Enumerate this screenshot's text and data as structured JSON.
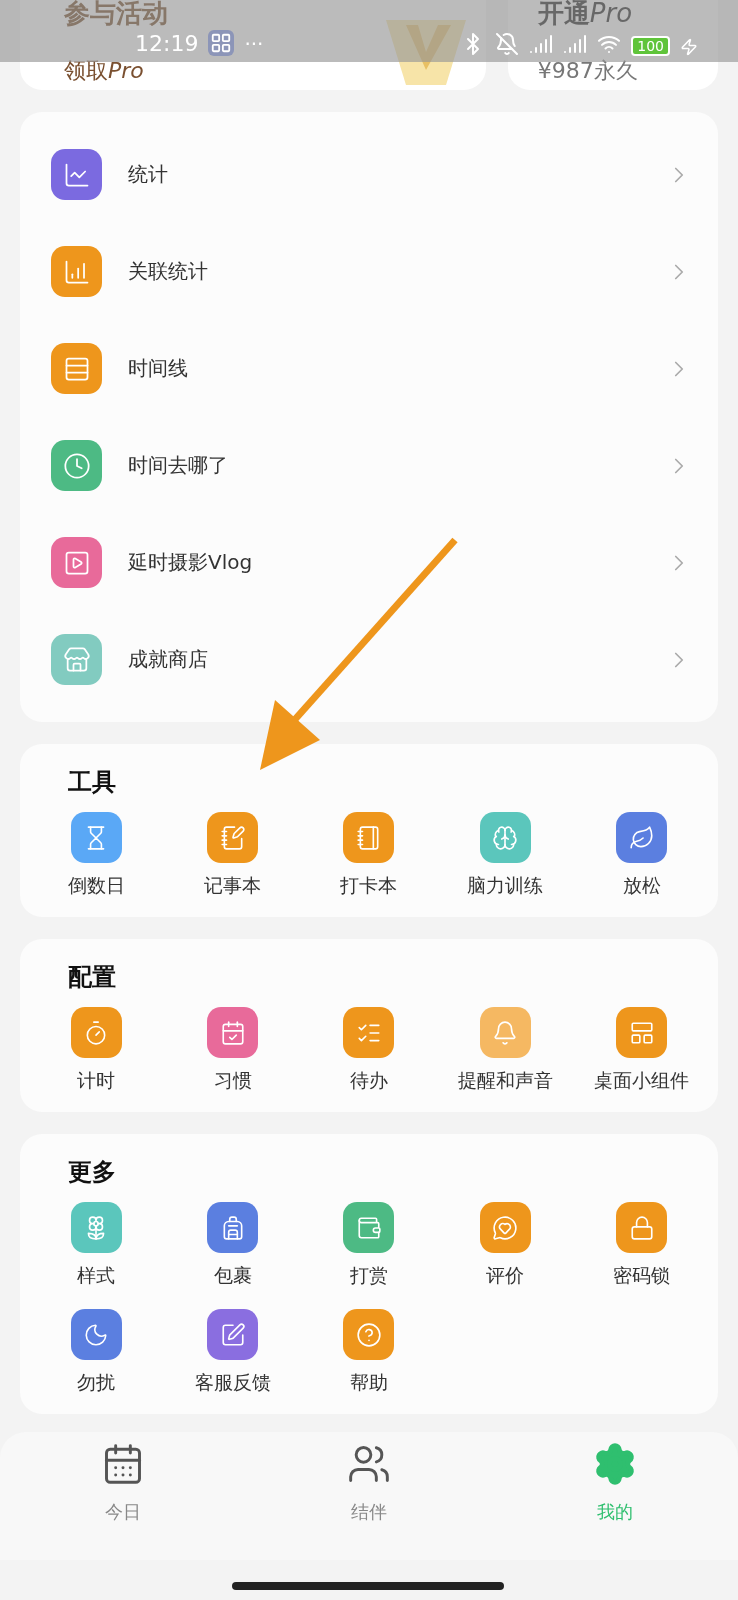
{
  "status_bar": {
    "time": "12:19",
    "more": "···",
    "battery": "100"
  },
  "promo_cards": [
    {
      "title": "参与活动",
      "subtitle": "领取",
      "subtitle_italic": "Pro"
    },
    {
      "title": "开通",
      "title_italic": "Pro",
      "subtitle": "¥987永久"
    }
  ],
  "menu_items": [
    {
      "label": "统计",
      "color": "#7b6ae0"
    },
    {
      "label": "关联统计",
      "color": "#ee961c"
    },
    {
      "label": "时间线",
      "color": "#ee961c"
    },
    {
      "label": "时间去哪了",
      "color": "#4dba84"
    },
    {
      "label": "延时摄影Vlog",
      "color": "#e86a9a"
    },
    {
      "label": "成就商店",
      "color": "#82cbc0"
    }
  ],
  "sections": [
    {
      "title": "工具",
      "items": [
        {
          "label": "倒数日",
          "color": "#5aa8f6"
        },
        {
          "label": "记事本",
          "color": "#ee961c"
        },
        {
          "label": "打卡本",
          "color": "#ee961c"
        },
        {
          "label": "脑力训练",
          "color": "#5bc6bc"
        },
        {
          "label": "放松",
          "color": "#5b7fe0"
        }
      ]
    },
    {
      "title": "配置",
      "items": [
        {
          "label": "计时",
          "color": "#ee961c"
        },
        {
          "label": "习惯",
          "color": "#e86a9a"
        },
        {
          "label": "待办",
          "color": "#ee961c"
        },
        {
          "label": "提醒和声音",
          "color": "#f5b862"
        },
        {
          "label": "桌面小组件",
          "color": "#ee961c"
        }
      ]
    },
    {
      "title": "更多",
      "items": [
        {
          "label": "样式",
          "color": "#5bc6bc"
        },
        {
          "label": "包裹",
          "color": "#5b7fe0"
        },
        {
          "label": "打赏",
          "color": "#4dba84"
        },
        {
          "label": "评价",
          "color": "#ee961c"
        },
        {
          "label": "密码锁",
          "color": "#ee961c"
        },
        {
          "label": "勿扰",
          "color": "#5b7fe0"
        },
        {
          "label": "客服反馈",
          "color": "#8a6ee0"
        },
        {
          "label": "帮助",
          "color": "#ee961c"
        }
      ]
    }
  ],
  "bottom_nav": [
    {
      "label": "今日",
      "selected": false
    },
    {
      "label": "结伴",
      "selected": false
    },
    {
      "label": "我的",
      "selected": true
    }
  ]
}
